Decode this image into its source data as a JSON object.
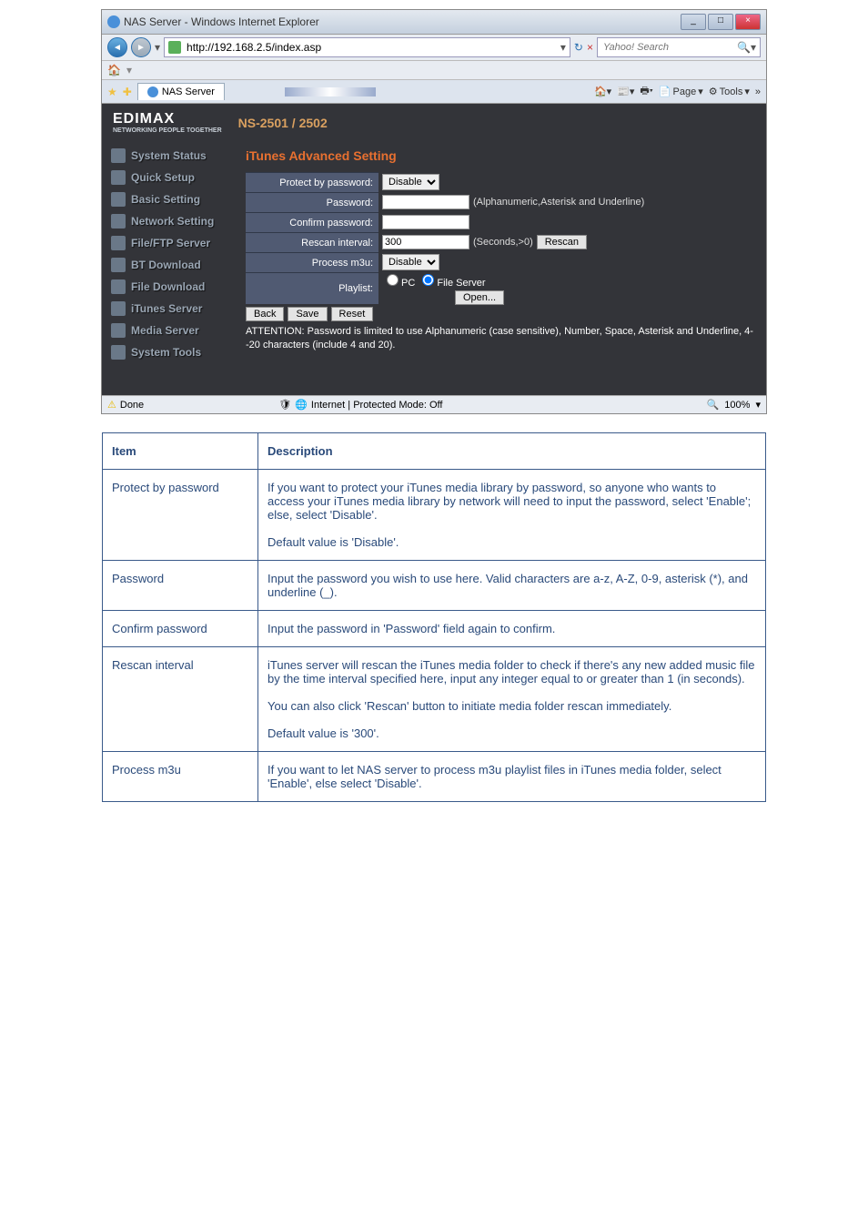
{
  "window": {
    "title": "NAS Server - Windows Internet Explorer"
  },
  "address": {
    "url": "http://192.168.2.5/index.asp"
  },
  "search": {
    "placeholder": "Yahoo! Search"
  },
  "tab": {
    "label": "NAS Server"
  },
  "ietools": {
    "page": "Page",
    "tools": "Tools"
  },
  "brand": {
    "name": "EDIMAX",
    "tagline": "NETWORKING PEOPLE TOGETHER",
    "model": "NS-2501 / 2502"
  },
  "nav": {
    "items": [
      "System Status",
      "Quick Setup",
      "Basic Setting",
      "Network Setting",
      "File/FTP Server",
      "BT Download",
      "File Download",
      "iTunes Server",
      "Media Server",
      "System Tools"
    ]
  },
  "panel": {
    "title": "iTunes Advanced Setting",
    "rows": {
      "protect": {
        "label": "Protect by password:",
        "value": "Disable"
      },
      "password": {
        "label": "Password:",
        "hint": "(Alphanumeric,Asterisk and Underline)"
      },
      "confirm": {
        "label": "Confirm password:"
      },
      "rescan": {
        "label": "Rescan interval:",
        "value": "300",
        "hint": "(Seconds,>0)",
        "btn": "Rescan"
      },
      "m3u": {
        "label": "Process m3u:",
        "value": "Disable"
      },
      "playlist": {
        "label": "Playlist:",
        "pc": "PC",
        "fs": "File Server",
        "open": "Open..."
      }
    },
    "buttons": {
      "back": "Back",
      "save": "Save",
      "reset": "Reset"
    },
    "attention": "ATTENTION: Password is limited to use Alphanumeric (case sensitive), Number, Space, Asterisk and Underline, 4--20 characters (include 4 and 20)."
  },
  "status": {
    "done": "Done",
    "zone": "Internet | Protected Mode: Off",
    "zoom": "100%"
  },
  "spec": {
    "header": {
      "item": "Item",
      "desc": "Description"
    },
    "rows": [
      {
        "item": "Protect by password",
        "desc": "If you want to protect your iTunes media library by password, so anyone who wants to access your iTunes media library by network will need to input the password, select 'Enable'; else, select 'Disable'.\n\nDefault value is 'Disable'."
      },
      {
        "item": "Password",
        "desc": "Input the password you wish to use here. Valid characters are a-z, A-Z, 0-9, asterisk (*), and underline (_)."
      },
      {
        "item": "Confirm password",
        "desc": "Input the password in 'Password' field again to confirm."
      },
      {
        "item": "Rescan interval",
        "desc": "iTunes server will rescan the iTunes media folder to check if there's any new added music file by the time interval specified here, input any integer equal to or greater than 1 (in seconds).\n\nYou can also click 'Rescan' button to initiate media folder rescan immediately.\n\nDefault value is '300'."
      },
      {
        "item": "Process m3u",
        "desc": "If you want to let NAS server to process m3u playlist files in iTunes media folder, select 'Enable', else select 'Disable'."
      }
    ]
  }
}
